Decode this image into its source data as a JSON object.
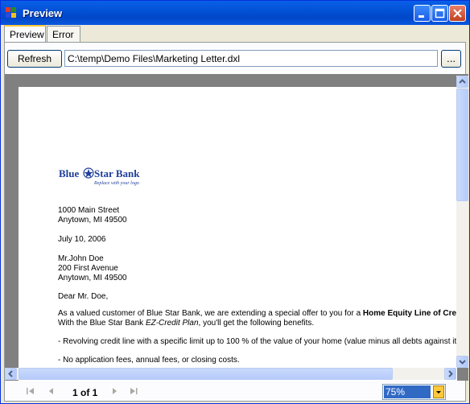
{
  "window": {
    "title": "Preview"
  },
  "tabs": [
    {
      "label": "Preview"
    },
    {
      "label": "Error"
    }
  ],
  "toolbar": {
    "refresh_label": "Refresh",
    "path_value": "C:\\temp\\Demo Files\\Marketing Letter.dxl",
    "browse_label": "..."
  },
  "document": {
    "logo_text": "Blue Star Bank",
    "logo_tagline": "Replace with your logo",
    "lines": [
      {
        "text": "1000 Main Street"
      },
      {
        "text": "Anytown, MI 49500"
      },
      {
        "text": "July 10, 2006"
      },
      {
        "text": "Mr.John Doe"
      },
      {
        "text": "200 First Avenue"
      },
      {
        "text": "Anytown, MI 49500"
      },
      {
        "text": "Dear Mr. Doe,"
      },
      {
        "text": "As a valued customer of Blue Star Bank, we are extending a special offer to you for a ",
        "bold": "Home Equity Line of Cre"
      },
      {
        "text": "With the Blue Star Bank ",
        "italic": "EZ-Credit Plan",
        "after": ", you'll get the following benefits."
      },
      {
        "text": "- Revolving credit line with a specific limit up to 100 % of the value of your home (value minus all debts against it"
      },
      {
        "text": "- No application fees, annual fees, or closing costs."
      }
    ]
  },
  "navigation": {
    "page_indicator": "1 of 1"
  },
  "zoom": {
    "value": "75%"
  },
  "colors": {
    "accent": "#316ac5",
    "titlebar": "#0352d6"
  }
}
